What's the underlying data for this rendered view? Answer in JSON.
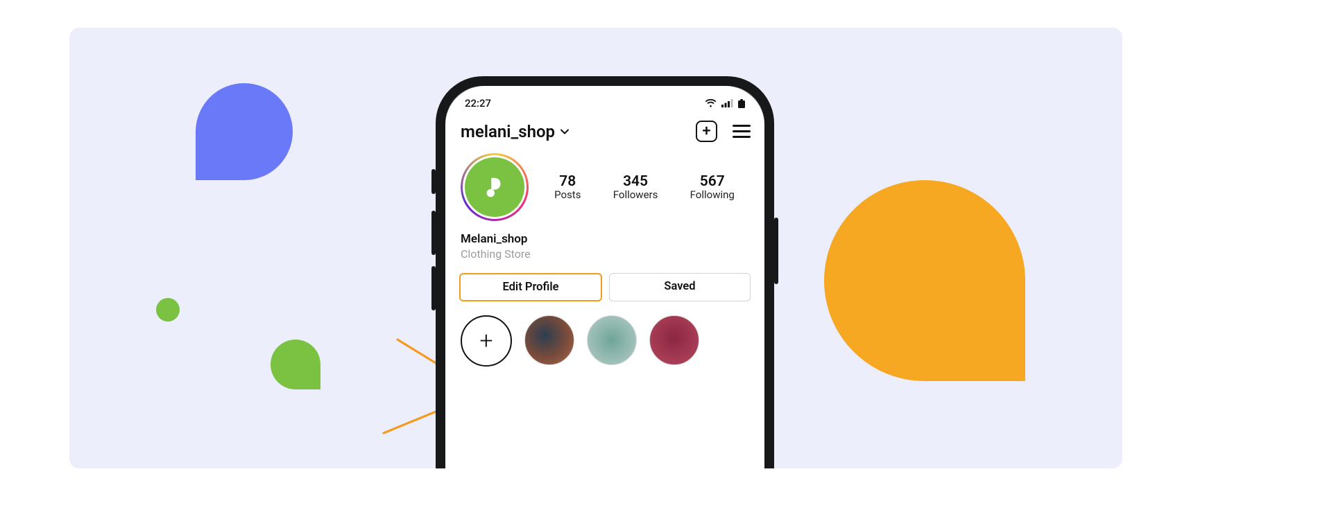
{
  "status": {
    "time": "22:27"
  },
  "header": {
    "username": "melani_shop"
  },
  "stats": {
    "posts": {
      "count": "78",
      "label": "Posts"
    },
    "followers": {
      "count": "345",
      "label": "Followers"
    },
    "following": {
      "count": "567",
      "label": "Following"
    }
  },
  "bio": {
    "name": "Melani_shop",
    "category": "Clothing Store"
  },
  "buttons": {
    "edit": "Edit Profile",
    "saved": "Saved"
  }
}
